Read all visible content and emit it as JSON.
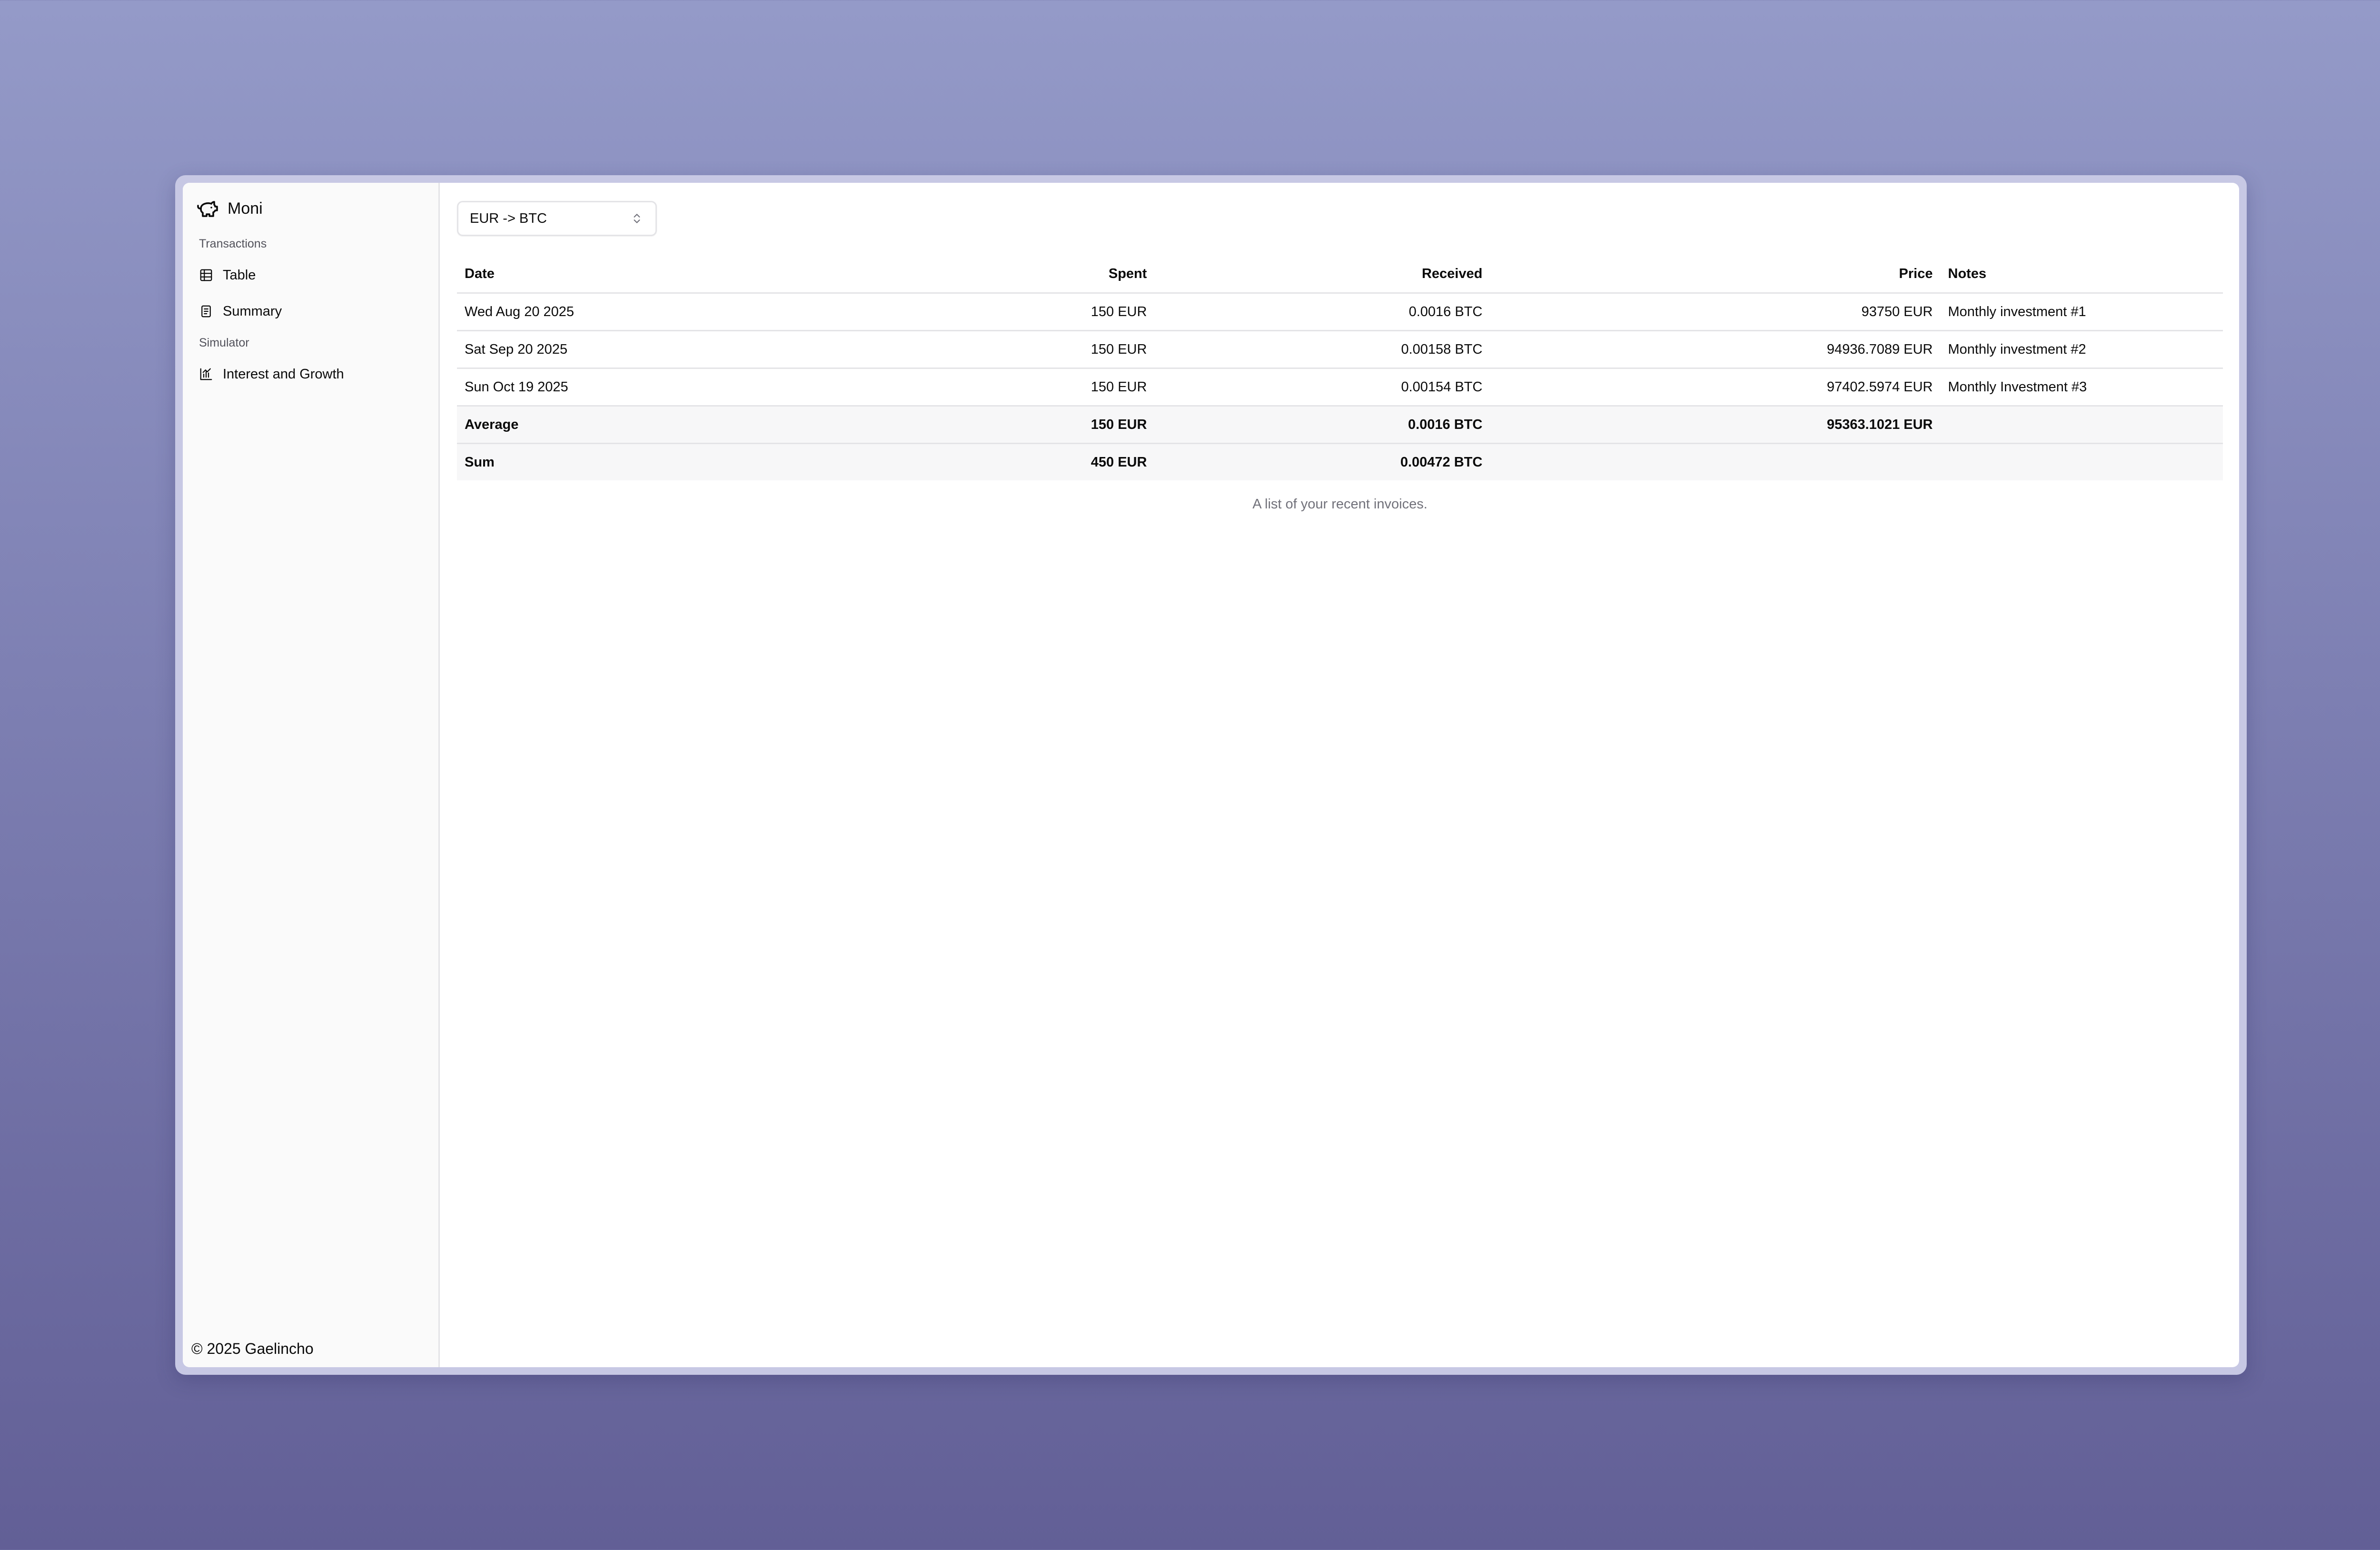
{
  "app": {
    "name": "Moni",
    "footer": "© 2025 Gaelincho"
  },
  "sidebar": {
    "groups": [
      {
        "label": "Transactions",
        "items": [
          {
            "label": "Table",
            "icon": "table-icon"
          },
          {
            "label": "Summary",
            "icon": "document-icon"
          }
        ]
      },
      {
        "label": "Simulator",
        "items": [
          {
            "label": "Interest and Growth",
            "icon": "chart-icon"
          }
        ]
      }
    ]
  },
  "pair_select": {
    "value": "EUR -> BTC",
    "icon": "chevrons-up-down-icon"
  },
  "table": {
    "headers": {
      "date": "Date",
      "spent": "Spent",
      "received": "Received",
      "price": "Price",
      "notes": "Notes"
    },
    "rows": [
      {
        "date": "Wed Aug 20 2025",
        "spent": "150 EUR",
        "received": "0.0016 BTC",
        "price": "93750 EUR",
        "notes": "Monthly investment #1"
      },
      {
        "date": "Sat Sep 20 2025",
        "spent": "150 EUR",
        "received": "0.00158 BTC",
        "price": "94936.7089 EUR",
        "notes": "Monthly investment #2"
      },
      {
        "date": "Sun Oct 19 2025",
        "spent": "150 EUR",
        "received": "0.00154 BTC",
        "price": "97402.5974 EUR",
        "notes": "Monthly Investment #3"
      }
    ],
    "average": {
      "label": "Average",
      "spent": "150 EUR",
      "received": "0.0016 BTC",
      "price": "95363.1021 EUR"
    },
    "sum": {
      "label": "Sum",
      "spent": "450 EUR",
      "received": "0.00472 BTC"
    },
    "caption": "A list of your recent invoices."
  },
  "colors": {
    "background_top": "#949ac8",
    "background_bottom": "#625f96",
    "sidebar_bg": "#fafafa",
    "border": "#e4e4e7",
    "muted_text": "#71717a"
  }
}
